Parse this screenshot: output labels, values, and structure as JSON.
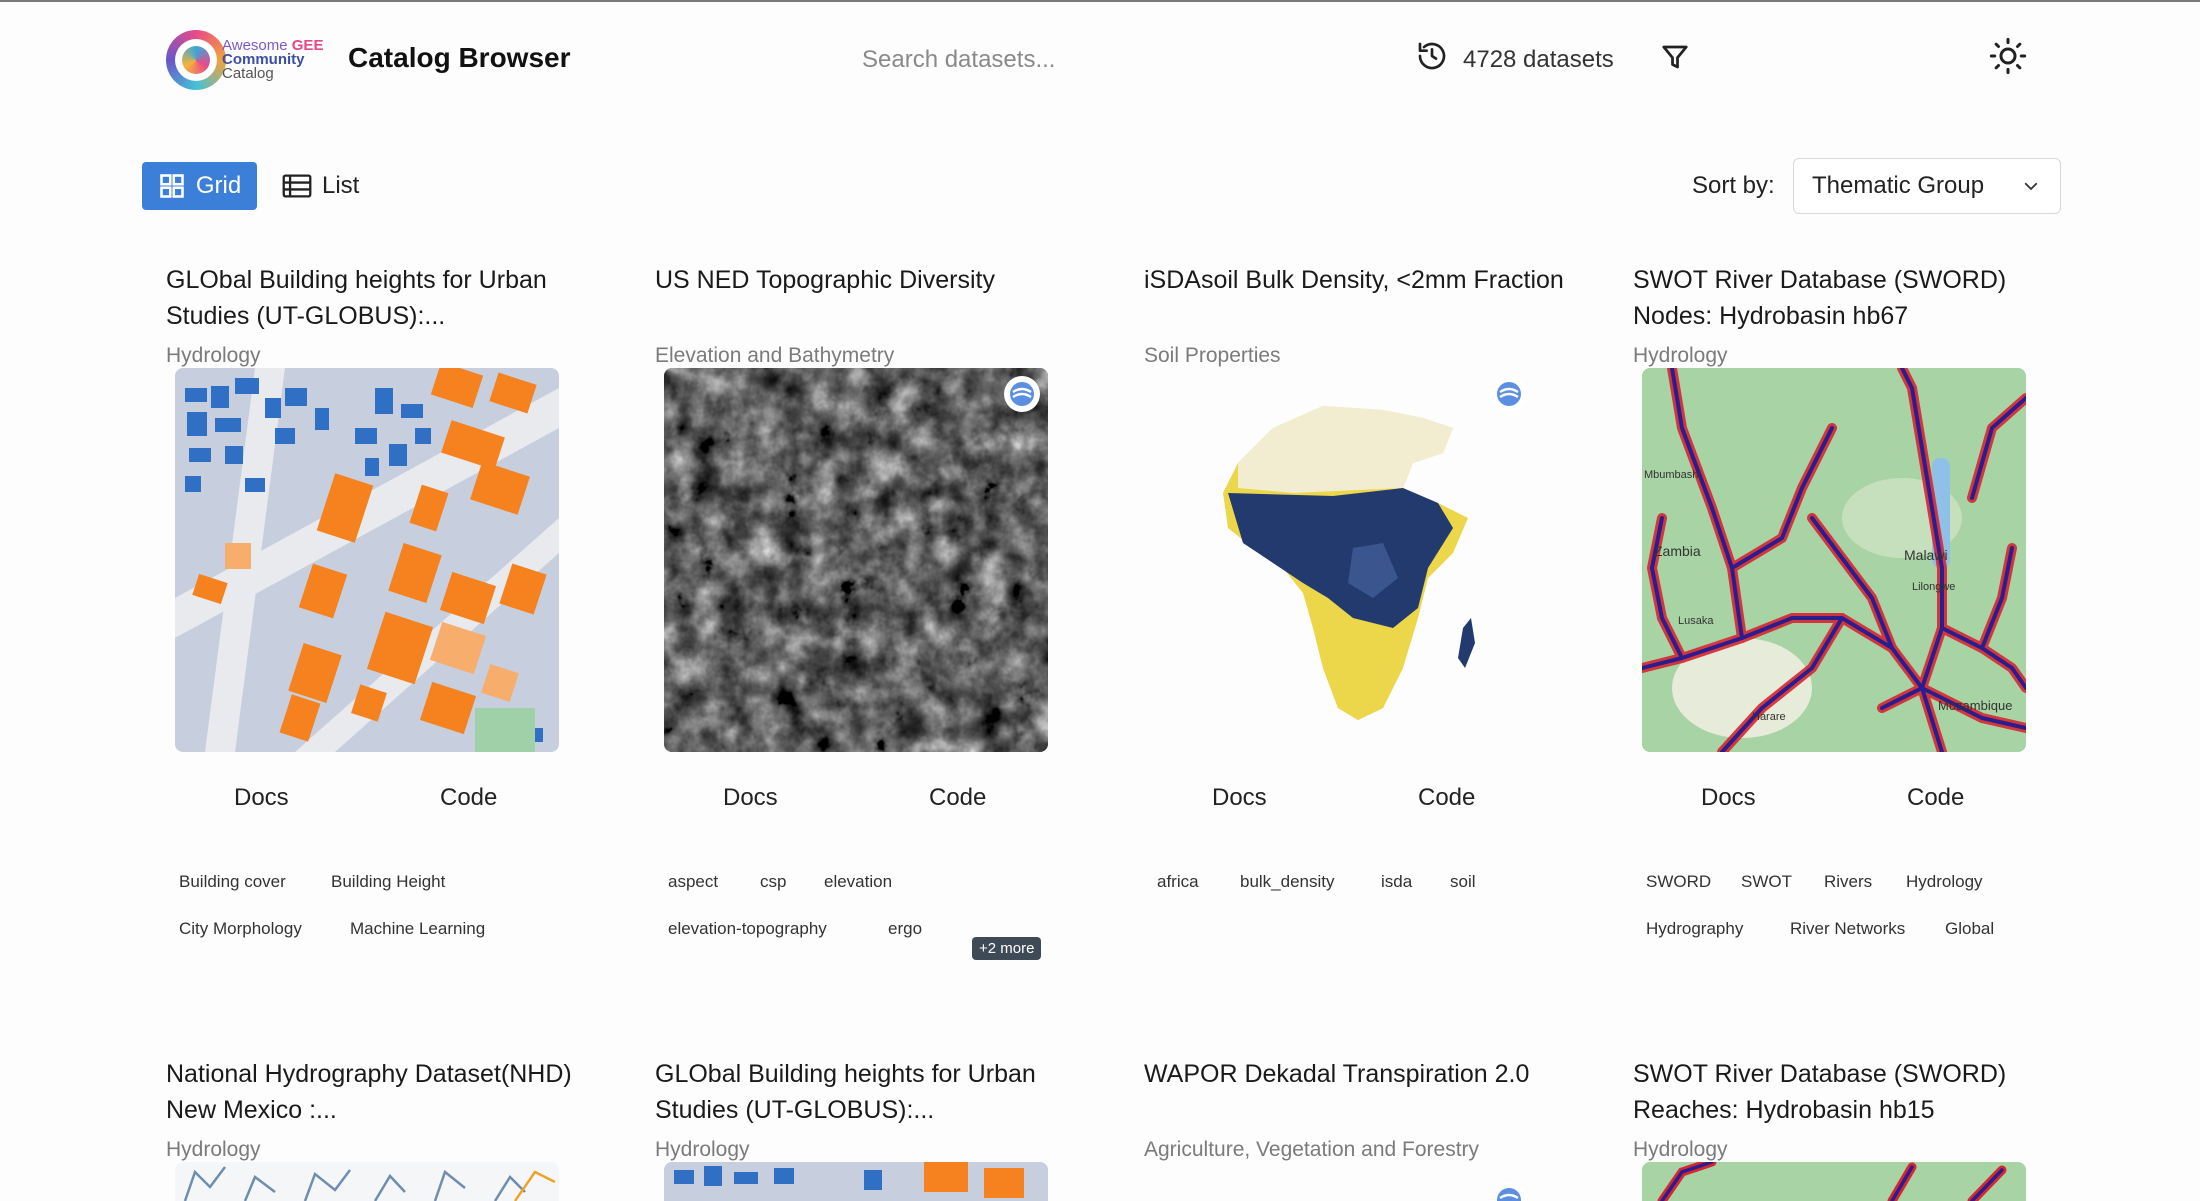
{
  "header": {
    "logo": {
      "line1a": "Awesome",
      "line1b": "GEE",
      "line2": "Community",
      "line3": "Catalog"
    },
    "title": "Catalog Browser",
    "search_placeholder": "Search datasets...",
    "dataset_count": "4728 datasets",
    "icons": {
      "history": "history-icon",
      "filter": "filter-icon",
      "theme": "sun-icon"
    }
  },
  "toolbar": {
    "grid_label": "Grid",
    "list_label": "List",
    "sort_label": "Sort by:",
    "sort_value": "Thematic Group",
    "accent": "#3b7fd9"
  },
  "cards": [
    {
      "title": "GLObal Building heights for Urban Studies (UT-GLOBUS):...",
      "category": "Hydrology",
      "docs": "Docs",
      "code": "Code",
      "tags": [
        "Building cover",
        "Building Height",
        "City Morphology",
        "Machine Learning"
      ],
      "more": ""
    },
    {
      "title": "US NED Topographic Diversity",
      "category": "Elevation and Bathymetry",
      "docs": "Docs",
      "code": "Code",
      "tags": [
        "aspect",
        "csp",
        "elevation",
        "elevation-topography",
        "ergo"
      ],
      "more": "+2 more"
    },
    {
      "title": "iSDAsoil Bulk Density, <2mm Fraction",
      "category": "Soil Properties",
      "docs": "Docs",
      "code": "Code",
      "tags": [
        "africa",
        "bulk_density",
        "isda",
        "soil"
      ],
      "more": ""
    },
    {
      "title": "SWOT River Database (SWORD) Nodes: Hydrobasin hb67",
      "category": "Hydrology",
      "docs": "Docs",
      "code": "Code",
      "tags": [
        "SWORD",
        "SWOT",
        "Rivers",
        "Hydrology",
        "Hydrography",
        "River Networks",
        "Global"
      ],
      "more": "",
      "map_labels": [
        "Zambia",
        "Malawi",
        "Lilongwe",
        "Lusaka",
        "Harare",
        "Mozambique",
        "Mbumbashi"
      ]
    },
    {
      "title": "National Hydrography Dataset(NHD) New Mexico :...",
      "category": "Hydrology"
    },
    {
      "title": "GLObal Building heights for Urban Studies (UT-GLOBUS):...",
      "category": "Hydrology"
    },
    {
      "title": "WAPOR Dekadal Transpiration 2.0",
      "category": "Agriculture, Vegetation and Forestry"
    },
    {
      "title": "SWOT River Database (SWORD) Reaches: Hydrobasin hb15",
      "category": "Hydrology"
    }
  ]
}
